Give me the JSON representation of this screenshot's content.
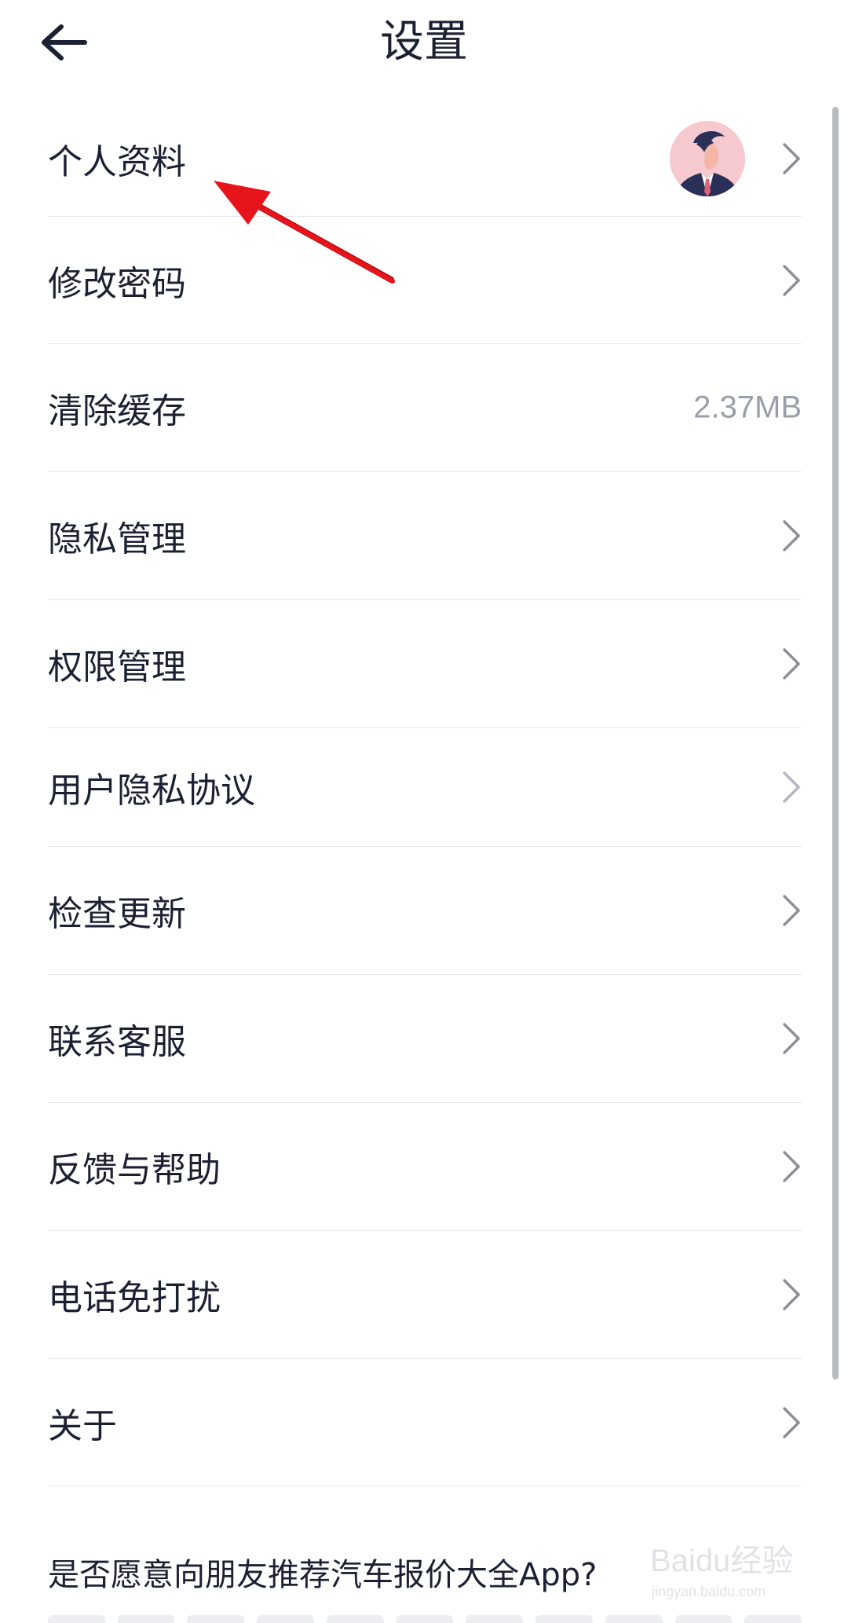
{
  "header": {
    "title": "设置"
  },
  "settings": {
    "items": [
      {
        "label": "个人资料",
        "has_avatar": true,
        "has_chevron": true
      },
      {
        "label": "修改密码",
        "has_chevron": true
      },
      {
        "label": "清除缓存",
        "value": "2.37MB",
        "has_chevron": false
      },
      {
        "label": "隐私管理",
        "has_chevron": true
      },
      {
        "label": "权限管理",
        "has_chevron": true
      },
      {
        "label": "用户隐私协议",
        "has_chevron": true
      },
      {
        "label": "检查更新",
        "has_chevron": true
      },
      {
        "label": "联系客服",
        "has_chevron": true
      },
      {
        "label": "反馈与帮助",
        "has_chevron": true
      },
      {
        "label": "电话免打扰",
        "has_chevron": true
      },
      {
        "label": "关于",
        "has_chevron": true
      }
    ]
  },
  "recommend": {
    "question": "是否愿意向朋友推荐汽车报价大全App?"
  },
  "watermark": {
    "brand": "Baidu经验",
    "url": "jingyan.baidu.com"
  },
  "icons": {
    "back": "arrow-left-icon",
    "chevron": "chevron-right-icon",
    "avatar": "user-avatar-illustration"
  },
  "colors": {
    "text": "#1c2033",
    "secondary": "#9a9eaa",
    "divider": "#e7e8ec",
    "chevron": "#8c8f99",
    "annotation": "#e8141b",
    "avatar_bg": "#f4c6cc"
  }
}
